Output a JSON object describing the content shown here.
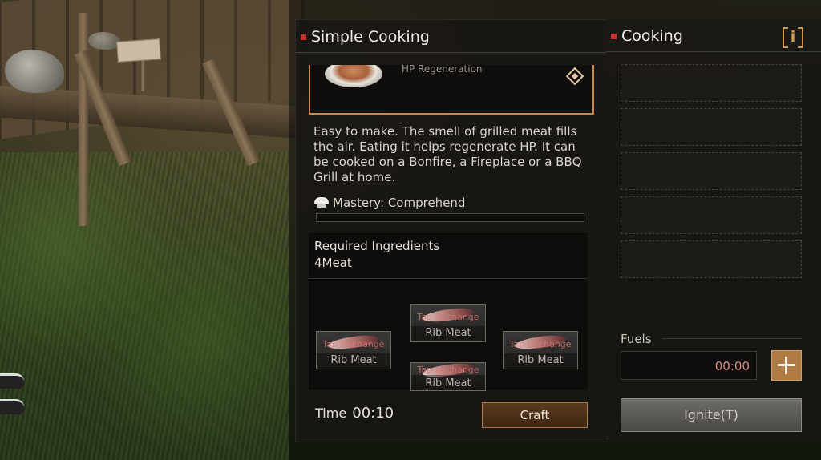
{
  "recipe_panel": {
    "title": "Simple Cooking",
    "dish_subtitle": "HP Regeneration",
    "description": "Easy to make. The smell of grilled meat fills the air. Eating it helps regenerate HP. It can be cooked on a Bonfire, a Fireplace or a BBQ Grill at home.",
    "mastery": "Mastery: Comprehend",
    "mastery_progress": 0,
    "ingredients_header": "Required Ingredients",
    "ingredients_value": "4Meat",
    "slots": [
      {
        "hint": "Tap to change",
        "name": "Rib Meat"
      },
      {
        "hint": "Tap to change",
        "name": "Rib Meat"
      },
      {
        "hint": "Tap to change",
        "name": "Rib Meat"
      },
      {
        "hint": "Tap to change",
        "name": "Rib Meat"
      }
    ],
    "time_label": "Time",
    "time_value": "00:10",
    "craft_label": "Craft"
  },
  "cooking_panel": {
    "title": "Cooking",
    "info_label": "i",
    "fuels_label": "Fuels",
    "fuel_timer": "00:00",
    "ignite_label": "Ignite(T)"
  },
  "colors": {
    "accent_orange": "#c78a4a",
    "title_dot_red": "#c8322a",
    "timer_text": "#d98a7a"
  },
  "icons": [
    "info-icon",
    "favorite-diamond-icon",
    "chef-hat-icon",
    "plus-icon",
    "rib-meat-icon"
  ]
}
